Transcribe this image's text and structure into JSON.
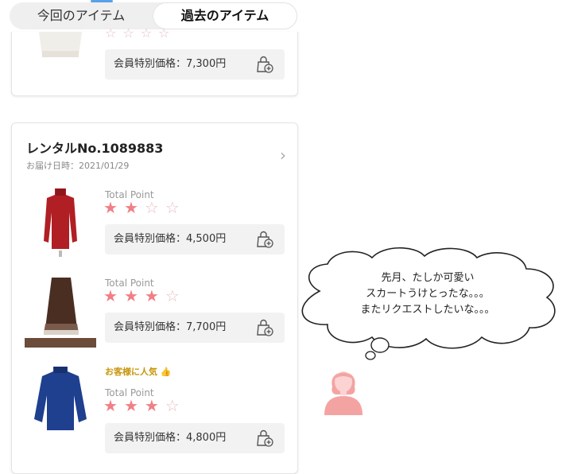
{
  "tabs": {
    "current": "今回のアイテム",
    "past": "過去のアイテム"
  },
  "previous_card": {
    "price_label": "会員特別価格：7,300円",
    "rating": 0
  },
  "rental": {
    "title": "レンタルNo.1089883",
    "delivery_date": "お届け日時：2021/01/29",
    "items": [
      {
        "name": "red-turtleneck-sweater",
        "total_point_label": "Total Point",
        "rating": 2,
        "max_rating": 4,
        "price_label": "会員特別価格：4,500円",
        "badge": ""
      },
      {
        "name": "brown-check-skirt",
        "total_point_label": "Total Point",
        "rating": 3,
        "max_rating": 4,
        "price_label": "会員特別価格：7,700円",
        "badge": ""
      },
      {
        "name": "blue-knit-sweater",
        "total_point_label": "Total Point",
        "rating": 3,
        "max_rating": 4,
        "price_label": "会員特別価格：4,800円",
        "badge": "お客様に人気 👍"
      }
    ]
  },
  "speech": {
    "line1": "先月、たしか可愛い",
    "line2": "スカートうけとったな。。。",
    "line3": "またリクエストしたいな。。。"
  },
  "colors": {
    "star_on": "#f07f86",
    "star_off": "#e8c1c4",
    "badge": "#c8960c",
    "person": "#f4a3a3"
  }
}
